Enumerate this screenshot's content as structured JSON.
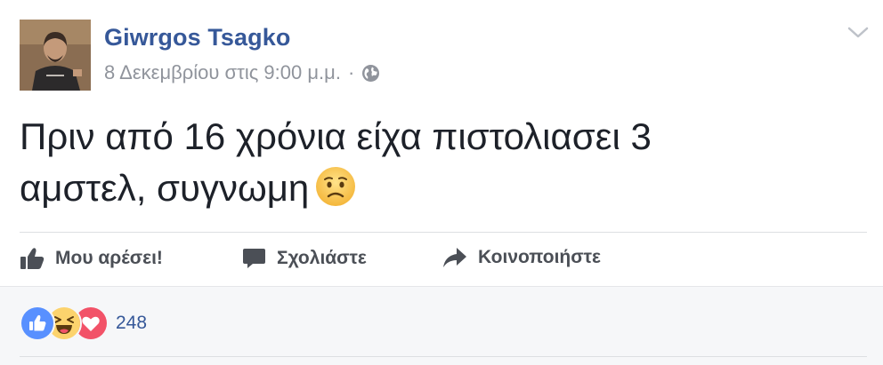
{
  "post": {
    "author": "Giwrgos Tsagko",
    "timestamp": "8 Δεκεμβρίου στις 9:00 μ.μ.",
    "separator": "·",
    "privacy_icon": "globe-icon",
    "menu_icon": "chevron-down-icon",
    "text_line1": "Πριν από 16 χρόνια είχα πιστολιασει 3",
    "text_line2": "αμστελ, συγνωμη",
    "emoji": "worried-face-emoji"
  },
  "actions": {
    "like_label": "Μου αρέσει!",
    "comment_label": "Σχολιάστε",
    "share_label": "Κοινοποιήστε"
  },
  "reactions": {
    "types": [
      "like",
      "haha",
      "love"
    ],
    "count": "248"
  },
  "colors": {
    "author": "#365899",
    "meta": "#90949c",
    "text": "#1d2129",
    "action": "#4b4f56",
    "like_blue": "#5890ff",
    "love_red": "#f25268",
    "haha_yellow": "#fcd36d",
    "footer_bg": "#f6f7f9"
  }
}
